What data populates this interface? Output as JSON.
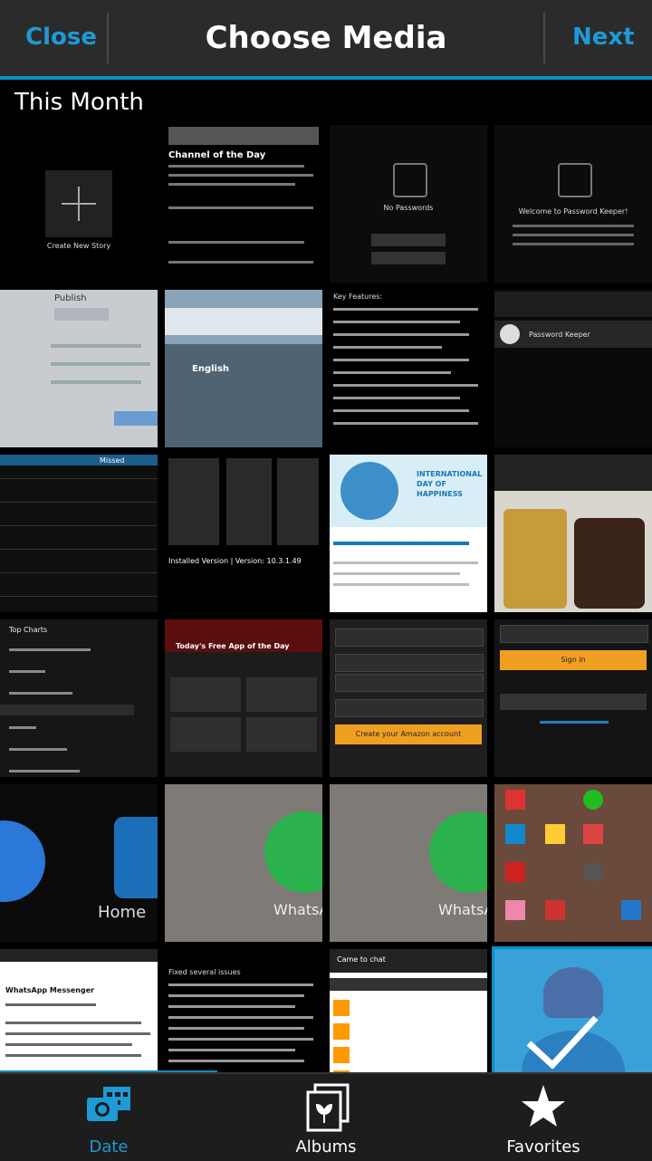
{
  "header": {
    "close_label": "Close",
    "title": "Choose Media",
    "next_label": "Next"
  },
  "section": {
    "title": "This Month"
  },
  "tiles": [
    {
      "caption": "Create New Story",
      "name": "create-new-story-tile"
    },
    {
      "caption": "Channel of the Day",
      "name": "channel-of-day-screenshot"
    },
    {
      "caption": "No Passwords",
      "name": "no-passwords-screenshot"
    },
    {
      "caption": "Welcome to Password Keeper!",
      "name": "password-keeper-welcome-screenshot"
    },
    {
      "caption": "Publish",
      "name": "publish-photo"
    },
    {
      "caption": "English",
      "name": "browser-photo"
    },
    {
      "caption": "Key Features:",
      "name": "key-features-screenshot"
    },
    {
      "caption": "Password Keeper",
      "name": "password-keeper-list-screenshot"
    },
    {
      "caption": "Missed",
      "name": "call-log-screenshot"
    },
    {
      "caption": "Installed Version | Version: 10.3.1.49",
      "name": "app-version-screenshot"
    },
    {
      "caption": "INTERNATIONAL DAY OF HAPPINESS",
      "name": "happiness-day-screenshot"
    },
    {
      "caption": "",
      "name": "coffee-photo"
    },
    {
      "caption": "Top Charts",
      "name": "store-menu-screenshot"
    },
    {
      "caption": "Today's Free App of the Day",
      "name": "free-app-screenshot"
    },
    {
      "caption": "Create your Amazon account",
      "name": "amazon-signup-screenshot"
    },
    {
      "caption": "Sign in",
      "name": "amazon-signin-screenshot"
    },
    {
      "caption": "Home",
      "name": "home-icons-zoom-photo"
    },
    {
      "caption": "WhatsApp",
      "name": "whatsapp-zoom-photo-1"
    },
    {
      "caption": "WhatsApp",
      "name": "whatsapp-zoom-photo-2"
    },
    {
      "caption": "",
      "name": "homescreen-screenshot"
    },
    {
      "caption": "WhatsApp Messenger",
      "name": "whatsapp-info-screenshot"
    },
    {
      "caption": "Fixed several issues",
      "name": "changelog-screenshot"
    },
    {
      "caption": "Came to chat",
      "name": "chat-screenshot"
    },
    {
      "caption": "",
      "name": "selected-blue-image"
    }
  ],
  "tabs": [
    {
      "label": "Date",
      "icon": "calendar-camera-icon",
      "active": true
    },
    {
      "label": "Albums",
      "icon": "albums-icon",
      "active": false
    },
    {
      "label": "Favorites",
      "icon": "star-icon",
      "active": false
    }
  ],
  "colors": {
    "accent": "#0a8fc9",
    "bar": "#2b2b2b"
  }
}
